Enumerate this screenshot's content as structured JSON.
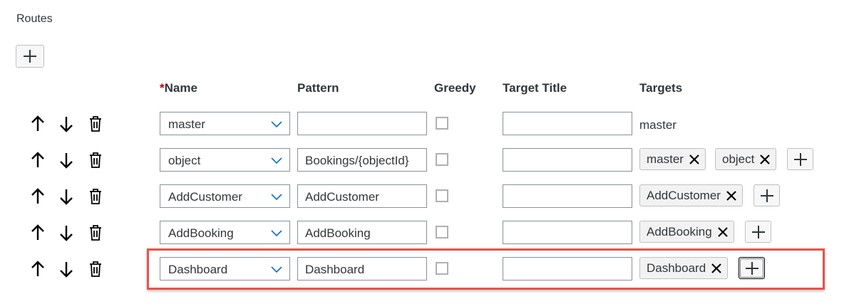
{
  "section": {
    "title": "Routes"
  },
  "columns": {
    "name_required_marker": "*",
    "name": "Name",
    "pattern": "Pattern",
    "greedy": "Greedy",
    "target_title": "Target Title",
    "targets": "Targets"
  },
  "icons": {
    "add": "plus-icon",
    "move_up": "arrow-up-icon",
    "move_down": "arrow-down-icon",
    "delete": "trash-icon",
    "dropdown": "chevron-down-icon",
    "remove_token": "close-icon"
  },
  "colors": {
    "highlight_border": "#e8524a",
    "required_marker": "#bb0000",
    "text": "#32363a"
  },
  "routes": [
    {
      "name": "master",
      "pattern": "",
      "greedy": false,
      "target_title": "",
      "targets_text": "master",
      "targets": []
    },
    {
      "name": "object",
      "pattern": "Bookings/{objectId}",
      "greedy": false,
      "target_title": "",
      "targets": [
        "master",
        "object"
      ]
    },
    {
      "name": "AddCustomer",
      "pattern": "AddCustomer",
      "greedy": false,
      "target_title": "",
      "targets": [
        "AddCustomer"
      ]
    },
    {
      "name": "AddBooking",
      "pattern": "AddBooking",
      "greedy": false,
      "target_title": "",
      "targets": [
        "AddBooking"
      ]
    },
    {
      "name": "Dashboard",
      "pattern": "Dashboard",
      "greedy": false,
      "target_title": "",
      "targets": [
        "Dashboard"
      ],
      "highlighted": true
    }
  ]
}
